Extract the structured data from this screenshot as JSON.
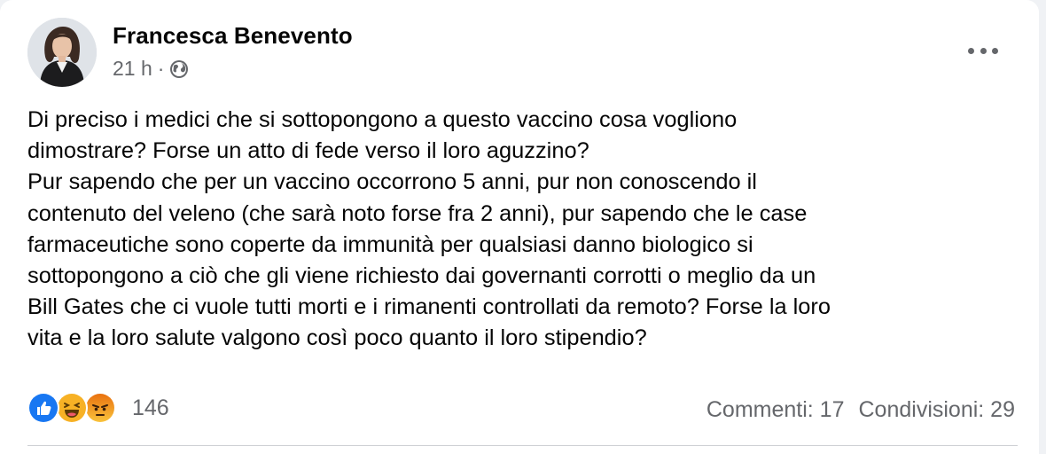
{
  "post": {
    "author": "Francesca Benevento",
    "time": "21 h",
    "separator": "·",
    "privacy_icon": "globe-icon",
    "more_icon": "more-options-icon",
    "text_lines": [
      "Di preciso i medici che si sottopongono a questo vaccino cosa vogliono",
      "dimostrare? Forse un atto di fede verso il loro aguzzino?",
      "Pur sapendo che per un vaccino occorrono 5 anni, pur non conoscendo il",
      "contenuto del veleno (che sarà noto forse fra 2 anni), pur sapendo che le case",
      "farmaceutiche sono coperte da immunità per qualsiasi danno biologico si",
      "sottopongono a ciò che gli viene richiesto dai governanti corrotti o meglio da un",
      "Bill Gates che ci vuole tutti morti e i rimanenti controllati da remoto? Forse la loro",
      "vita e la loro salute valgono così poco quanto il loro stipendio?"
    ]
  },
  "reactions": {
    "icons": [
      "like-reaction-icon",
      "haha-reaction-icon",
      "angry-reaction-icon"
    ],
    "count": "146"
  },
  "stats": {
    "comments": "Commenti: 17",
    "shares": "Condivisioni: 29"
  },
  "colors": {
    "like_blue": "#1877f2",
    "haha_yellow": "#f7b125",
    "angry_orange": "#e9710f",
    "secondary_text": "#65676b"
  }
}
